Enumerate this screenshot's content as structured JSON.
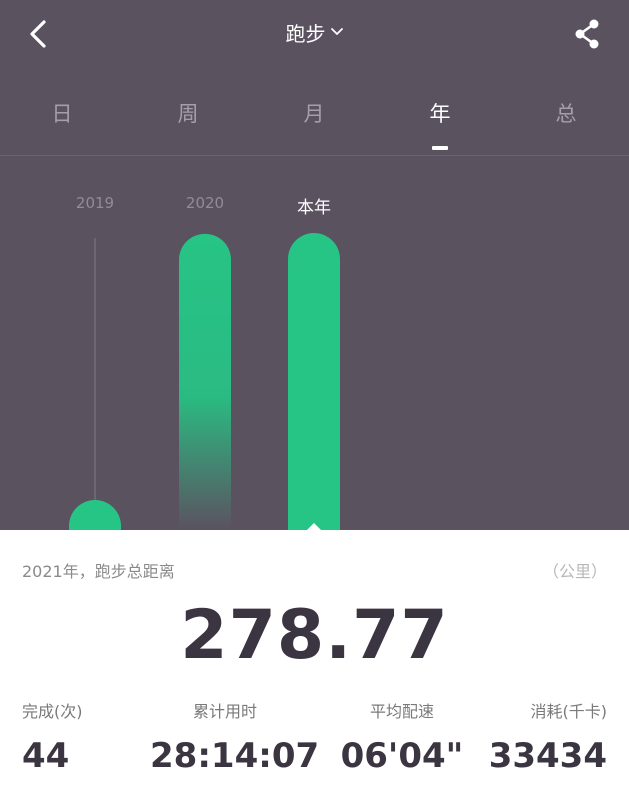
{
  "header": {
    "title": "跑步",
    "back_icon": "chevron-left-icon",
    "dropdown_icon": "chevron-down-icon",
    "share_icon": "share-icon"
  },
  "tabs": [
    {
      "label": "日",
      "active": false
    },
    {
      "label": "周",
      "active": false
    },
    {
      "label": "月",
      "active": false
    },
    {
      "label": "年",
      "active": true
    },
    {
      "label": "总",
      "active": false
    }
  ],
  "chart_data": {
    "type": "bar",
    "categories": [
      "2019",
      "2020",
      "本年"
    ],
    "values": [
      18,
      278,
      278.77
    ],
    "selected_index": 2,
    "colors": {
      "bar": "#26c485",
      "background": "#5b5260"
    }
  },
  "summary": {
    "label": "2021年，跑步总距离",
    "unit": "（公里）",
    "total": "278.77"
  },
  "stats": [
    {
      "label": "完成(次)",
      "value": "44"
    },
    {
      "label": "累计用时",
      "value": "28:14:07"
    },
    {
      "label": "平均配速",
      "value": "06'04\""
    },
    {
      "label": "消耗(千卡)",
      "value": "33434"
    }
  ]
}
